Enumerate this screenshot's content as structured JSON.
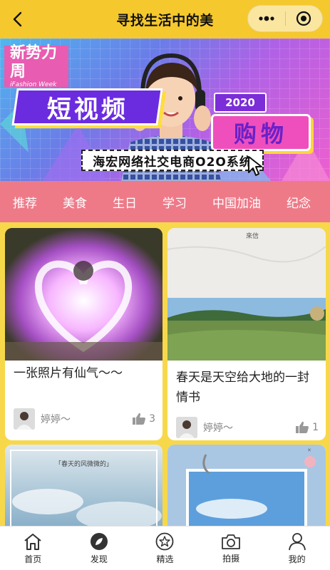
{
  "nav": {
    "title": "寻找生活中的美"
  },
  "banner": {
    "logo_cn": "新势力周",
    "logo_en": "iFashion Week",
    "headline": "短视频",
    "year": "2020",
    "shopping": "购物",
    "system_label": "海宏网络社交电商O2O系统"
  },
  "tabs": [
    "推荐",
    "美食",
    "生日",
    "学习",
    "中国加油",
    "纪念"
  ],
  "cards": [
    {
      "title": "一张照片有仙气～～",
      "author": "婷婷～",
      "likes": "3"
    },
    {
      "title": "春天是天空给大地的一封情书",
      "author": "婷婷～",
      "likes": "1"
    },
    {
      "title": "",
      "author": "",
      "likes": "",
      "caption": "「春天的风微微的」"
    },
    {
      "title": "",
      "author": "",
      "likes": ""
    }
  ],
  "bottom_nav": [
    {
      "label": "首页",
      "icon": "home-icon"
    },
    {
      "label": "发现",
      "icon": "compass-icon"
    },
    {
      "label": "精选",
      "icon": "star-icon"
    },
    {
      "label": "拍摄",
      "icon": "camera-icon"
    },
    {
      "label": "我的",
      "icon": "user-icon"
    }
  ],
  "colors": {
    "topbar": "#f5c82e",
    "tabs_bg": "#ee7a88",
    "feed_bg": "#f7d84a"
  }
}
